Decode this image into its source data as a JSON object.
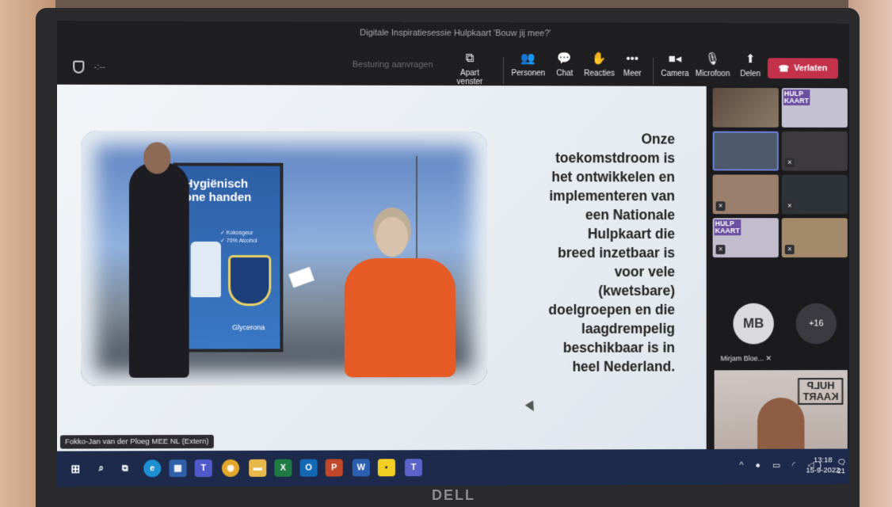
{
  "window": {
    "title": "Digitale Inspiratiesessie Hulpkaart 'Bouw jij mee?'",
    "dots": "-:--",
    "request_control": "Besturing aanvragen"
  },
  "toolbar": {
    "popout": "Apart venster",
    "people": "Personen",
    "chat": "Chat",
    "reactions": "Reacties",
    "more": "Meer",
    "camera": "Camera",
    "microphone": "Microfoon",
    "share": "Delen",
    "leave": "Verlaten"
  },
  "slide": {
    "poster_headline": "Hygiënisch\none handen",
    "poster_small": "✓ Kokosgeur\n✓ 70% Alcohol",
    "poster_brand": "Glycerona",
    "text": "Onze\ntoekomstdroom is\nhet ontwikkelen en\nimplementeren van\neen Nationale\nHulpkaart die\nbreed inzetbaar is\nvoor vele\n(kwetsbare)\ndoelgroepen en die\nlaagdrempelig\nbeschikbaar is in\nheel Nederland."
  },
  "presenter_tag": "Fokko-Jan van der Ploeg MEE NL (Extern)",
  "participants": {
    "logo_tile": "HULP\nKAART",
    "avatar_initials": "MB",
    "avatar_name": "Mirjam Bloe...",
    "overflow_count": "+16",
    "speaker_logo": "HULP\nKAART"
  },
  "taskbar": {
    "clock_time": "13:18",
    "clock_date": "15-9-2022",
    "notification_count": "21"
  },
  "device": {
    "brand": "DELL"
  }
}
